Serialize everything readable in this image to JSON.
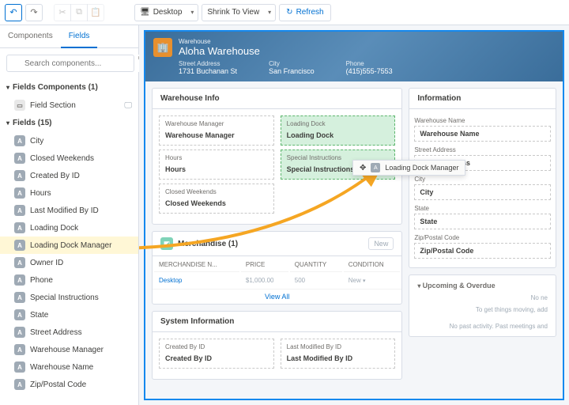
{
  "toolbar": {
    "device": "Desktop",
    "zoom": "Shrink To View",
    "refresh": "Refresh"
  },
  "tabs": {
    "components": "Components",
    "fields": "Fields"
  },
  "search": {
    "placeholder": "Search components..."
  },
  "sections": {
    "fieldsComponents": "Fields Components (1)",
    "fieldSection": "Field Section",
    "fields": "Fields (15)"
  },
  "fieldsList": [
    "City",
    "Closed Weekends",
    "Created By ID",
    "Hours",
    "Last Modified By ID",
    "Loading Dock",
    "Loading Dock Manager",
    "Owner ID",
    "Phone",
    "Special Instructions",
    "State",
    "Street Address",
    "Warehouse Manager",
    "Warehouse Name",
    "Zip/Postal Code"
  ],
  "page": {
    "objectLabel": "Warehouse",
    "title": "Aloha Warehouse",
    "street": {
      "label": "Street Address",
      "value": "1731 Buchanan St"
    },
    "city": {
      "label": "City",
      "value": "San Francisco"
    },
    "phone": {
      "label": "Phone",
      "value": "(415)555-7553"
    }
  },
  "warehouseInfo": {
    "title": "Warehouse Info",
    "left": [
      {
        "label": "Warehouse Manager",
        "value": "Warehouse Manager"
      },
      {
        "label": "Hours",
        "value": "Hours"
      },
      {
        "label": "Closed Weekends",
        "value": "Closed Weekends"
      }
    ],
    "right": [
      {
        "label": "Loading Dock",
        "value": "Loading Dock"
      },
      {
        "label": "Special Instructions",
        "value": "Special Instructions"
      }
    ]
  },
  "merchandise": {
    "title": "Merchandise (1)",
    "new": "New",
    "cols": [
      "MERCHANDISE N...",
      "PRICE",
      "QUANTITY",
      "CONDITION"
    ],
    "row": [
      "Desktop",
      "$1,000.00",
      "500",
      "New"
    ],
    "viewAll": "View All"
  },
  "systemInfo": {
    "title": "System Information",
    "left": {
      "label": "Created By ID",
      "value": "Created By ID"
    },
    "right": {
      "label": "Last Modified By ID",
      "value": "Last Modified By ID"
    }
  },
  "information": {
    "title": "Information",
    "fields": [
      {
        "label": "Warehouse Name",
        "value": "Warehouse Name"
      },
      {
        "label": "Street Address",
        "value": "Street Address"
      },
      {
        "label": "City",
        "value": "City"
      },
      {
        "label": "State",
        "value": "State"
      },
      {
        "label": "Zip/Postal Code",
        "value": "Zip/Postal Code"
      }
    ]
  },
  "upcoming": {
    "title": "Upcoming & Overdue",
    "noNew": "No ne",
    "help": "To get things moving, add",
    "noPast": "No past activity. Past meetings and"
  },
  "dragGhost": "Loading Dock Manager"
}
